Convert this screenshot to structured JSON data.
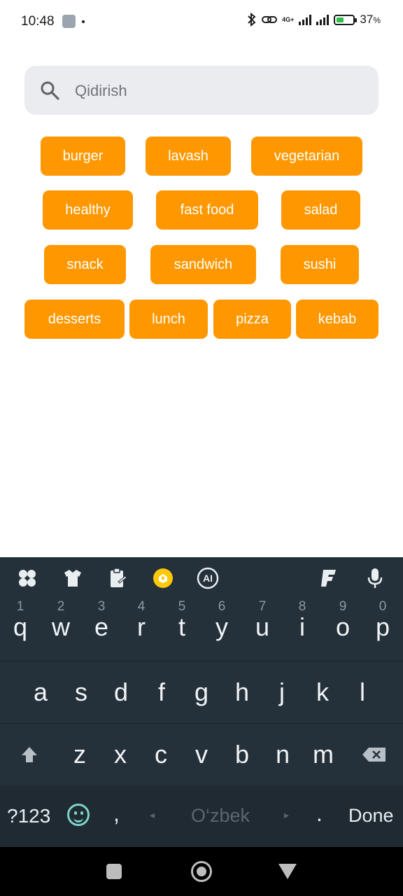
{
  "status": {
    "time": "10:48",
    "network": "4G+",
    "battery": "37",
    "battery_pct_sign": "%"
  },
  "search": {
    "placeholder": "Qidirish",
    "value": ""
  },
  "tags": [
    "burger",
    "lavash",
    "vegetarian",
    "healthy",
    "fast food",
    "salad",
    "snack",
    "sandwich",
    "sushi",
    "desserts",
    "lunch",
    "pizza",
    "kebab"
  ],
  "keyboard": {
    "toolbar_icons": [
      "apps-icon",
      "theme-icon",
      "clipboard-icon",
      "sticker-icon",
      "ai-icon",
      "font-icon",
      "microphone-icon"
    ],
    "toolbar_ai_label": "AI",
    "row1": [
      {
        "key": "q",
        "num": "1"
      },
      {
        "key": "w",
        "num": "2"
      },
      {
        "key": "e",
        "num": "3"
      },
      {
        "key": "r",
        "num": "4"
      },
      {
        "key": "t",
        "num": "5"
      },
      {
        "key": "y",
        "num": "6"
      },
      {
        "key": "u",
        "num": "7"
      },
      {
        "key": "i",
        "num": "8"
      },
      {
        "key": "o",
        "num": "9"
      },
      {
        "key": "p",
        "num": "0"
      }
    ],
    "row2": [
      "a",
      "s",
      "d",
      "f",
      "g",
      "h",
      "j",
      "k",
      "l"
    ],
    "row3": [
      "z",
      "x",
      "c",
      "v",
      "b",
      "n",
      "m"
    ],
    "symbols_label": "?123",
    "comma": ",",
    "space_label": "O‘zbek",
    "period": ".",
    "done_label": "Done"
  },
  "colors": {
    "accent": "#ff9800",
    "search_bg": "#ebecef",
    "keyboard_bg": "#24303a"
  }
}
